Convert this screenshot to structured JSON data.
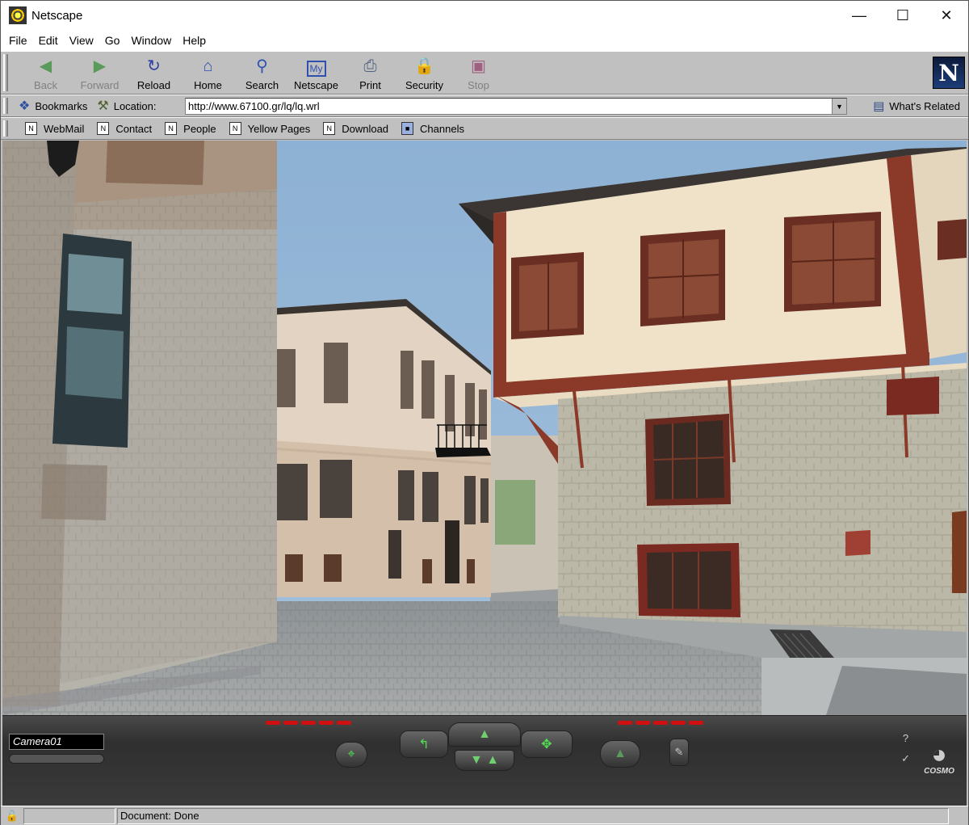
{
  "window": {
    "title": "Netscape"
  },
  "menu": [
    "File",
    "Edit",
    "View",
    "Go",
    "Window",
    "Help"
  ],
  "toolbar": {
    "buttons": [
      {
        "label": "Back",
        "icon": "back-arrow-icon",
        "enabled": false
      },
      {
        "label": "Forward",
        "icon": "forward-arrow-icon",
        "enabled": false
      },
      {
        "label": "Reload",
        "icon": "reload-icon",
        "enabled": true
      },
      {
        "label": "Home",
        "icon": "home-icon",
        "enabled": true
      },
      {
        "label": "Search",
        "icon": "search-icon",
        "enabled": true
      },
      {
        "label": "Netscape",
        "icon": "my-netscape-icon",
        "enabled": true
      },
      {
        "label": "Print",
        "icon": "print-icon",
        "enabled": true
      },
      {
        "label": "Security",
        "icon": "security-lock-icon",
        "enabled": true
      },
      {
        "label": "Stop",
        "icon": "stop-icon",
        "enabled": false
      }
    ]
  },
  "location": {
    "bookmarks_label": "Bookmarks",
    "location_label": "Location:",
    "url": "http://www.67100.gr/lq/lq.wrl",
    "related_label": "What's Related"
  },
  "personal": {
    "items": [
      "WebMail",
      "Contact",
      "People",
      "Yellow Pages",
      "Download",
      "Channels"
    ]
  },
  "cosmo": {
    "camera": "Camera01",
    "logo_text": "COSMO"
  },
  "status": {
    "text": "Document: Done"
  }
}
